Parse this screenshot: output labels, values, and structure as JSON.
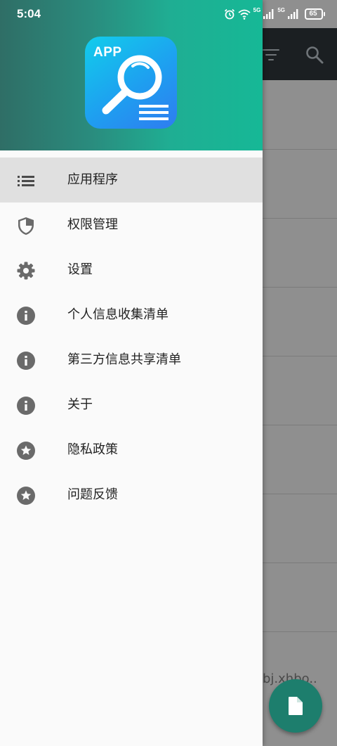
{
  "status_bar": {
    "time": "5:04",
    "signal1_label": "5G",
    "signal2_label": "5G",
    "battery": "65",
    "icons": [
      "alarm-icon",
      "wifi-icon",
      "signal-icon",
      "signal-icon",
      "battery-icon"
    ]
  },
  "drawer": {
    "logo_text": "APP",
    "header_colors": [
      "#2f6e66",
      "#16b896"
    ],
    "items": [
      {
        "label": "应用程序",
        "icon": "list-icon",
        "selected": true
      },
      {
        "label": "权限管理",
        "icon": "shield-icon",
        "selected": false
      },
      {
        "label": "设置",
        "icon": "gear-icon",
        "selected": false
      },
      {
        "label": "个人信息收集清单",
        "icon": "info-icon",
        "selected": false
      },
      {
        "label": "第三方信息共享清单",
        "icon": "info-icon",
        "selected": false
      },
      {
        "label": "关于",
        "icon": "info-icon",
        "selected": false
      },
      {
        "label": "隐私政策",
        "icon": "star-icon",
        "selected": false
      },
      {
        "label": "问题反馈",
        "icon": "star-icon",
        "selected": false
      }
    ]
  },
  "background": {
    "partial_text": "bj.xhbo..",
    "fab_icon": "file-icon",
    "toolbar_icons": [
      "filter-icon",
      "search-icon"
    ],
    "accent": "#1d7e6d"
  }
}
